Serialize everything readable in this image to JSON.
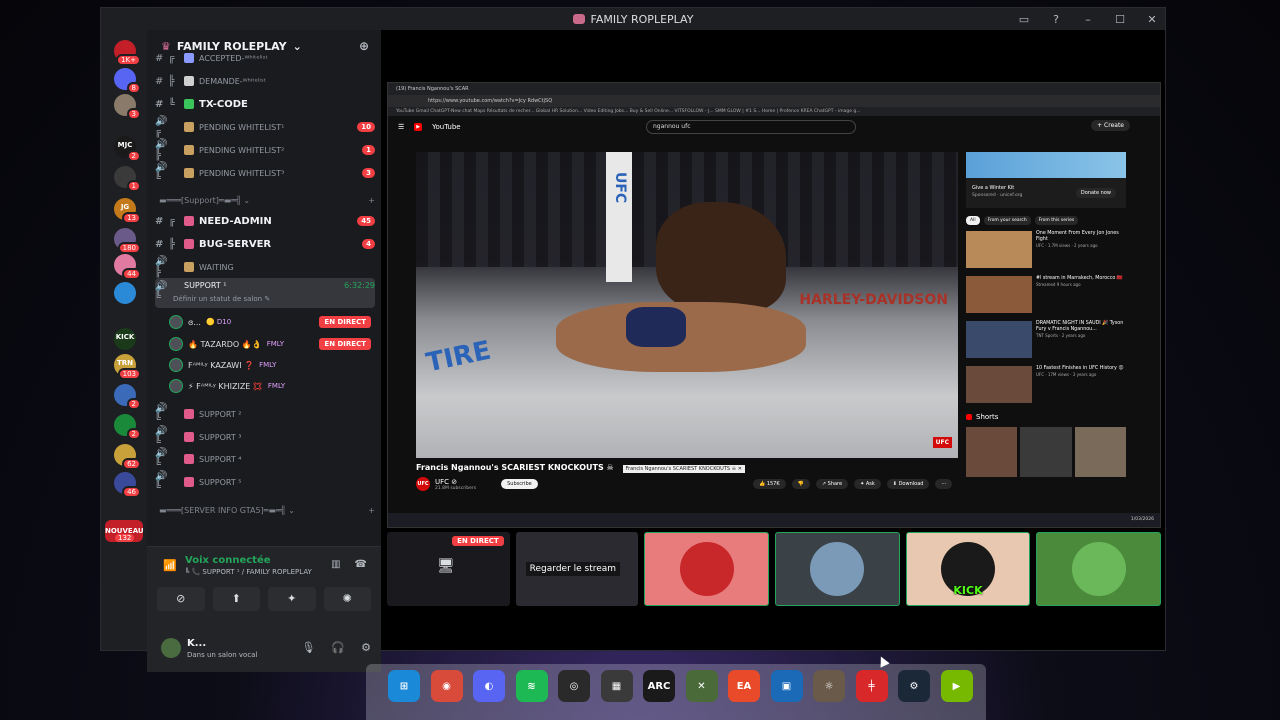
{
  "window": {
    "title": "FAMILY ROPLEPLAY",
    "controls": [
      "▭",
      "?",
      "–",
      "☐",
      "✕"
    ]
  },
  "servers": [
    {
      "label": "",
      "badge": "1K+",
      "color": "#c21f29"
    },
    {
      "label": "",
      "badge": "8",
      "color": "#5865f2"
    },
    {
      "label": "",
      "badge": "3",
      "color": "#8a7a6a"
    },
    {
      "label": "MJC",
      "badge": "2",
      "color": "#1a1a1a"
    },
    {
      "label": "",
      "badge": "1",
      "color": "#3a3a3a"
    },
    {
      "label": "JG",
      "badge": "13",
      "color": "#c47a1a"
    },
    {
      "label": "",
      "badge": "180",
      "color": "#6a5a8a"
    },
    {
      "label": "",
      "badge": "44",
      "color": "#e07aa0"
    },
    {
      "label": "",
      "badge": "",
      "color": "#2a8ad8"
    },
    {
      "label": "KICK",
      "badge": "",
      "color": "#1a3a1a"
    },
    {
      "label": "TRN",
      "badge": "103",
      "color": "#c9a13a"
    },
    {
      "label": "",
      "badge": "2",
      "color": "#3a6ab8"
    },
    {
      "label": "",
      "badge": "2",
      "color": "#1a8a3a"
    },
    {
      "label": "",
      "badge": "62",
      "color": "#c9a13a"
    },
    {
      "label": "",
      "badge": "46",
      "color": "#3a4a9a"
    }
  ],
  "new_badge": "NOUVEAU",
  "new_count": "132",
  "guild": {
    "name": "FAMILY ROLEPLAY"
  },
  "channels": [
    {
      "icon": "# ╔",
      "name": "ACCEPTED-ᵂʰⁱᵗᵉˡⁱˢᵗ",
      "mark": "#8a9aff",
      "count": "",
      "bright": false
    },
    {
      "icon": "# ╠",
      "name": "DEMANDE-ᵂʰⁱᵗᵉˡⁱˢᵗ",
      "mark": "#d0d0d0",
      "count": "",
      "bright": false
    },
    {
      "icon": "# ╚",
      "name": "tx-code",
      "mark": "#3ac45a",
      "count": "",
      "bright": true
    },
    {
      "icon": "🔊 ╔",
      "name": "PENDING WHITELIST¹",
      "mark": "#c8a060",
      "count": "10",
      "bright": false
    },
    {
      "icon": "🔊 ╠",
      "name": "PENDING WHITELIST²",
      "mark": "#c8a060",
      "count": "1",
      "bright": false
    },
    {
      "icon": "🔊 ╚",
      "name": "PENDING WHITELIST³",
      "mark": "#c8a060",
      "count": "3",
      "bright": false
    }
  ],
  "cat_support": "▬═══[Support]═▬═╣ ⌄",
  "support_channels": [
    {
      "icon": "# ╔",
      "name": "NEED-ADMIN",
      "mark": "#e05a8a",
      "count": "45",
      "bright": true
    },
    {
      "icon": "# ╠",
      "name": "BUG-SERVER",
      "mark": "#e05a8a",
      "count": "4",
      "bright": true
    },
    {
      "icon": "🔊 ╠",
      "name": "WAITING",
      "mark": "#c8a060",
      "count": "",
      "bright": false
    }
  ],
  "active_channel": {
    "icon": "🔊 ╚",
    "name": "SUPPORT ¹",
    "timer": "6:32:29",
    "status": "Définir un statut de salon ✎"
  },
  "voice_users": [
    {
      "name": "ɞ...",
      "tag": "🟡 D10",
      "live": "EN DIRECT"
    },
    {
      "name": "🔥 TAZARDO 🔥👌",
      "tag": "FMLY",
      "live": "EN DIRECT"
    },
    {
      "name": "Fᴬᴹᴵᴸʸ KAZAWI ❓",
      "tag": "FMLY",
      "live": ""
    },
    {
      "name": "⚡ Fᴬᴹᴵᴸʸ KHIZIZE 💢",
      "tag": "FMLY",
      "live": ""
    }
  ],
  "more_support": [
    "SUPPORT ²",
    "SUPPORT ³",
    "SUPPORT ⁴",
    "SUPPORT ⁵"
  ],
  "cat_gta": "▬═══[SERVER INFO GTA5]═▬═╣ ⌄",
  "voice_panel": {
    "status": "Voix connectée",
    "location": "╚ 📞 SUPPORT ¹ / FAMILY ROPLEPLAY",
    "buttons": [
      "⊘",
      "⬆",
      "✦",
      "✺"
    ]
  },
  "me": {
    "name": "K...",
    "status": "Dans un salon vocal"
  },
  "youtube": {
    "tab": "(19) Francis Ngannou's SCAR",
    "url": "https://www.youtube.com/watch?v=Jcy RdwCtjSQ",
    "bookmarks": "YouTube  Gmail  ChatGPT-New chat  Maps  Résultats de recher...  Global HR Solution...  Video Editing Jobs...  Buy & Sell Online...  VITSFOLLOW - J...  SMM GLOW | #1 S...  Home | Profence  KREA  ChatGPT - image g...",
    "search": "ngannou ufc",
    "create": "+ Create",
    "video_title": "Francis Ngannou's SCARIEST KNOCKOUTS ☠",
    "tooltip": "Francis Ngannou's SCARIEST KNOCKOUTS ☠ ✕",
    "channel": "UFC ⊘",
    "subs": "21.8M subscribers",
    "subscribe": "Subscribe",
    "actions": [
      "👍 157K",
      "👎",
      "↗ Share",
      "✦ Ask",
      "⬇ Download",
      "⋯"
    ],
    "ad_title": "Give a Winter Kit",
    "ad_sub": "Sponsored · unicef.org",
    "ad_btn": "Donate now",
    "chips": [
      "All",
      "From your search",
      "From this series"
    ],
    "recs": [
      {
        "title": "One Moment From Every Jon Jones Fight",
        "meta": "UFC · 1.7M views · 2 years ago",
        "color": "#b88a5a"
      },
      {
        "title": "#l stream in Marrakech, Morocco 🇲🇦",
        "meta": "Streamed 9 hours ago",
        "color": "#8a5a3a"
      },
      {
        "title": "DRAMATIC NIGHT IN SAUDI 🎉 Tyson Fury v Francis Ngannou...",
        "meta": "TNT Sports · 2 years ago",
        "color": "#3a4a6a"
      },
      {
        "title": "10 Fastest Finishes in UFC History 😮",
        "meta": "UFC · 17M views · 3 years ago",
        "color": "#6a4a3a"
      }
    ],
    "shorts": "Shorts",
    "clock": "1/03/2026"
  },
  "video_overlay": {
    "brand": "UFC",
    "post_text": "UFC",
    "banner": "HARLEY-DAVIDSON",
    "tire": "TIRE"
  },
  "tiles": [
    {
      "kind": "stream",
      "live": "EN DIRECT",
      "color": "#1a1a1e",
      "label": ""
    },
    {
      "kind": "watch",
      "live": "",
      "color": "#2a2a30",
      "label": "Regarder le stream"
    },
    {
      "kind": "avatar",
      "live": "",
      "color": "#e87c7c",
      "label": "",
      "circle": "#c8282a"
    },
    {
      "kind": "avatar",
      "live": "",
      "color": "#3a4248",
      "label": "",
      "circle": "#7a9ab8"
    },
    {
      "kind": "avatar",
      "live": "",
      "color": "#e8c8b0",
      "label": "KICK",
      "circle": "#1a1a1a"
    },
    {
      "kind": "avatar",
      "live": "",
      "color": "#4a8a3a",
      "label": "",
      "circle": "#6ab85a"
    }
  ],
  "dock": [
    {
      "name": "windows-icon",
      "glyph": "⊞",
      "color": "#1a8ad8"
    },
    {
      "name": "chrome-icon",
      "glyph": "◉",
      "color": "#d84a3a"
    },
    {
      "name": "discord-icon",
      "glyph": "◐",
      "color": "#5865f2"
    },
    {
      "name": "spotify-icon",
      "glyph": "≋",
      "color": "#1db954"
    },
    {
      "name": "obs-icon",
      "glyph": "◎",
      "color": "#2a2a2a"
    },
    {
      "name": "game-bar-icon",
      "glyph": "▦",
      "color": "#3a3a3a"
    },
    {
      "name": "arc-raiders-icon",
      "glyph": "ARC",
      "color": "#1a1a1a"
    },
    {
      "name": "rockstar-icon",
      "glyph": "✕",
      "color": "#4a6a3a"
    },
    {
      "name": "ea-icon",
      "glyph": "EA",
      "color": "#e84a2a"
    },
    {
      "name": "xbox-icon",
      "glyph": "▣",
      "color": "#1a6ab8"
    },
    {
      "name": "gta-icon",
      "glyph": "☼",
      "color": "#6a5a4a"
    },
    {
      "name": "faceit-icon",
      "glyph": "╪",
      "color": "#d8282a"
    },
    {
      "name": "steam-icon",
      "glyph": "⚙",
      "color": "#1b2838"
    },
    {
      "name": "nvidia-icon",
      "glyph": "▶",
      "color": "#76b900"
    }
  ]
}
